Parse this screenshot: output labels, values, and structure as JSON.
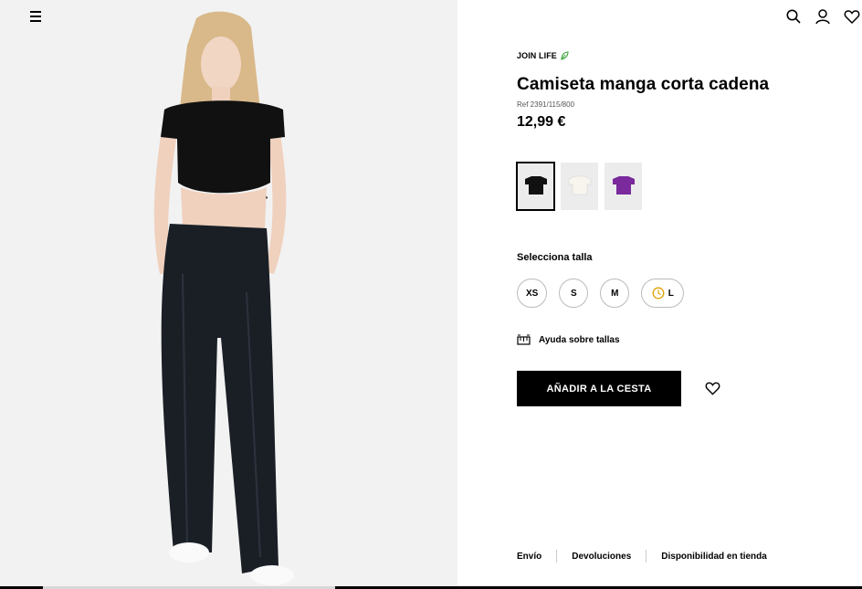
{
  "header": {
    "menu_icon": "hamburger-menu-icon",
    "icons": [
      "search-icon",
      "user-icon",
      "heart-icon"
    ]
  },
  "product": {
    "badge": "JOIN LIFE",
    "badge_icon": "leaf-icon",
    "title": "Camiseta manga corta cadena",
    "ref": "Ref 2391/115/800",
    "price": "12,99 €"
  },
  "colors": [
    {
      "name": "black",
      "hex": "#111111",
      "selected": true
    },
    {
      "name": "white",
      "hex": "#f4f2ea",
      "selected": false
    },
    {
      "name": "purple",
      "hex": "#7a2a9c",
      "selected": false
    }
  ],
  "sizes": {
    "label": "Selecciona talla",
    "options": [
      "XS",
      "S",
      "M",
      "L"
    ],
    "low_stock_icon": "clock-icon"
  },
  "help": {
    "label": "Ayuda sobre tallas",
    "icon": "ruler-icon"
  },
  "cart": {
    "button_label": "AÑADIR A LA CESTA",
    "favorite_icon": "heart-icon"
  },
  "footer": {
    "links": [
      "Envío",
      "Devoluciones",
      "Disponibilidad en tienda"
    ]
  },
  "theme": {
    "accent": "#000000",
    "leaf_color": "#3aa33a"
  }
}
